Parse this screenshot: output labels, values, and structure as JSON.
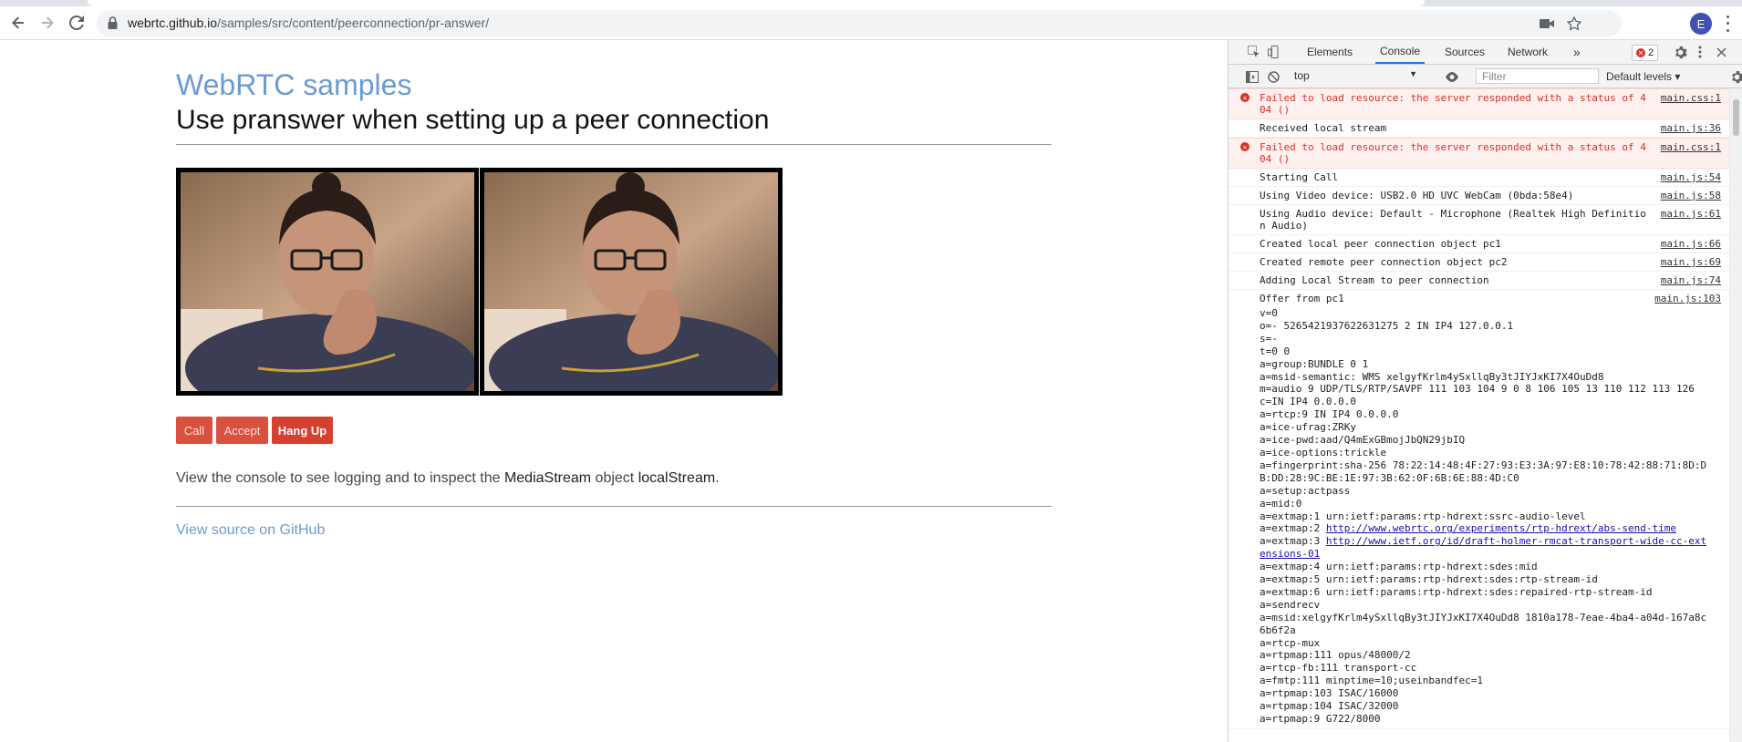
{
  "browser": {
    "url_host": "webrtc.github.io",
    "url_path": "/samples/src/content/peerconnection/pr-answer/",
    "avatar_letter": "E",
    "accent_color": "#3f51b5"
  },
  "page": {
    "site_title": "WebRTC samples",
    "title": "Use pranswer when setting up a peer connection",
    "buttons": {
      "call": "Call",
      "accept": "Accept",
      "hang_up": "Hang Up"
    },
    "button_color": "#d64031",
    "description": {
      "before": "View the console to see logging and to inspect the ",
      "code1": "MediaStream",
      "middle": " object ",
      "code2": "localStream",
      "after": "."
    },
    "source_link": "View source on GitHub",
    "link_color": "#6b9bd1"
  },
  "devtools": {
    "tabs": [
      "Elements",
      "Console",
      "Sources",
      "Network"
    ],
    "active_tab": "Console",
    "more_tabs": "»",
    "error_count": "2",
    "context": "top",
    "filter_placeholder": "Filter",
    "levels": "Default levels ▾",
    "logs": [
      {
        "type": "error",
        "msg": "Failed to load resource: the server responded with a status of 404 ()",
        "src": "main.css:1"
      },
      {
        "type": "info",
        "msg": "Received local stream",
        "src": "main.js:36"
      },
      {
        "type": "error",
        "msg": "Failed to load resource: the server responded with a status of 404 ()",
        "src": "main.css:1"
      },
      {
        "type": "info",
        "msg": "Starting Call",
        "src": "main.js:54"
      },
      {
        "type": "info",
        "msg": "Using Video device: USB2.0 HD UVC WebCam (0bda:58e4)",
        "src": "main.js:58"
      },
      {
        "type": "info",
        "msg": "Using Audio device: Default - Microphone (Realtek High Definition Audio)",
        "src": "main.js:61"
      },
      {
        "type": "info",
        "msg": "Created local peer connection object pc1",
        "src": "main.js:66"
      },
      {
        "type": "info",
        "msg": "Created remote peer connection object pc2",
        "src": "main.js:69"
      },
      {
        "type": "info",
        "msg": "Adding Local Stream to peer connection",
        "src": "main.js:74"
      }
    ],
    "offer": {
      "title": "Offer from pc1",
      "src": "main.js:103",
      "lines": [
        "v=0",
        "o=- 5265421937622631275 2 IN IP4 127.0.0.1",
        "s=-",
        "t=0 0",
        "a=group:BUNDLE 0 1",
        "a=msid-semantic: WMS xelgyfKrlm4ySxllqBy3tJIYJxKI7X4OuDd8",
        "m=audio 9 UDP/TLS/RTP/SAVPF 111 103 104 9 0 8 106 105 13 110 112 113 126",
        "c=IN IP4 0.0.0.0",
        "a=rtcp:9 IN IP4 0.0.0.0",
        "a=ice-ufrag:ZRKy",
        "a=ice-pwd:aad/Q4mExGBmojJbQN29jbIQ",
        "a=ice-options:trickle",
        "a=fingerprint:sha-256 78:22:14:48:4F:27:93:E3:3A:97:E8:10:78:42:88:71:8D:DB:DD:28:9C:BE:1E:97:3B:62:0F:6B:6E:88:4D:C0",
        "a=setup:actpass",
        "a=mid:0",
        "a=extmap:1 urn:ietf:params:rtp-hdrext:ssrc-audio-level",
        "a=extmap:2 ",
        "a=extmap:3 ",
        "a=extmap:4 urn:ietf:params:rtp-hdrext:sdes:mid",
        "a=extmap:5 urn:ietf:params:rtp-hdrext:sdes:rtp-stream-id",
        "a=extmap:6 urn:ietf:params:rtp-hdrext:sdes:repaired-rtp-stream-id",
        "a=sendrecv",
        "a=msid:xelgyfKrlm4ySxllqBy3tJIYJxKI7X4OuDd8 1810a178-7eae-4ba4-a04d-167a8c6b6f2a",
        "a=rtcp-mux",
        "a=rtpmap:111 opus/48000/2",
        "a=rtcp-fb:111 transport-cc",
        "a=fmtp:111 minptime=10;useinbandfec=1",
        "a=rtpmap:103 ISAC/16000",
        "a=rtpmap:104 ISAC/32000",
        "a=rtpmap:9 G722/8000"
      ],
      "link2": "http://www.webrtc.org/experiments/rtp-hdrext/abs-send-time",
      "link3": "http://www.ietf.org/id/draft-holmer-rmcat-transport-wide-cc-extensions-01"
    }
  }
}
